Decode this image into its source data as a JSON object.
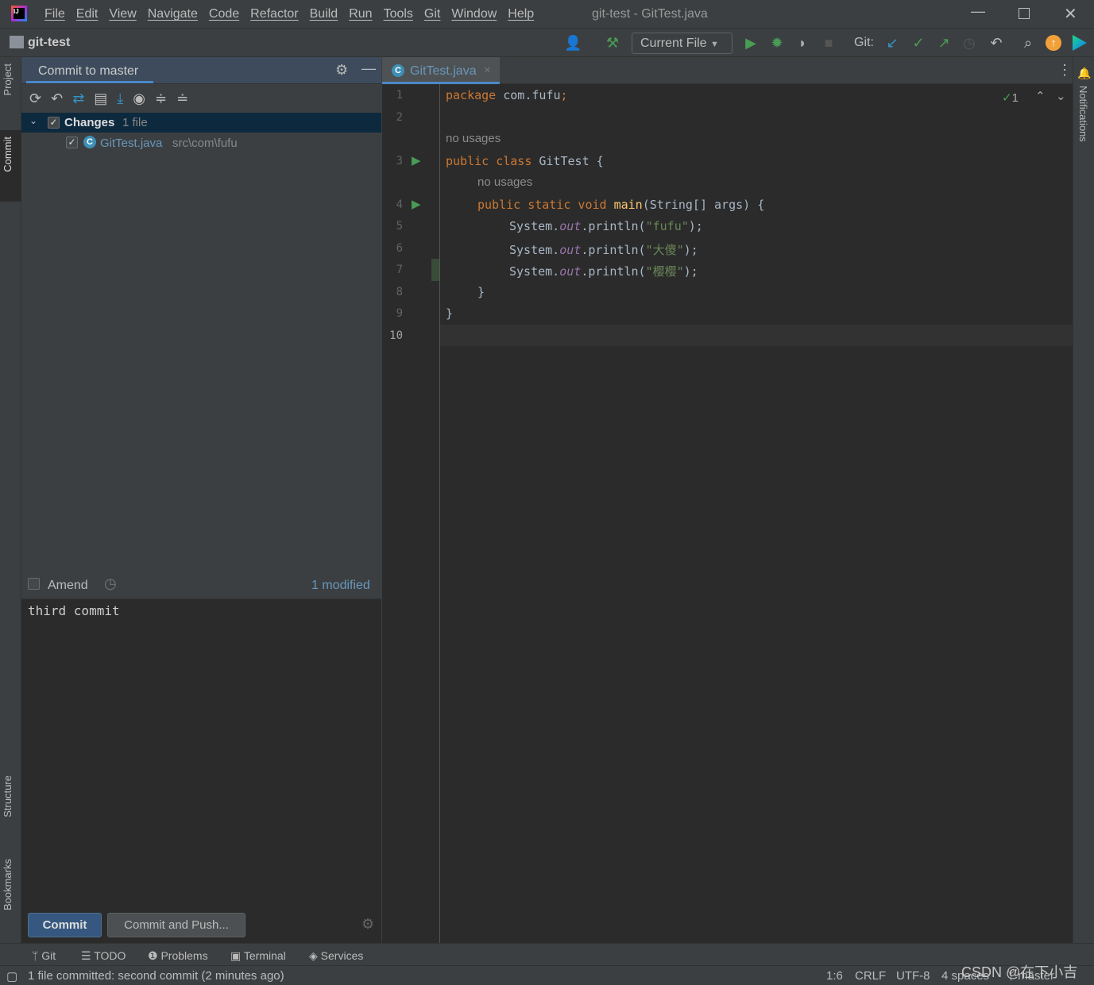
{
  "window": {
    "title": "git-test - GitTest.java",
    "menu": [
      "File",
      "Edit",
      "View",
      "Navigate",
      "Code",
      "Refactor",
      "Build",
      "Run",
      "Tools",
      "Git",
      "Window",
      "Help"
    ]
  },
  "nav": {
    "project": "git-test",
    "run_config": "Current File",
    "git_label": "Git:"
  },
  "left_strip": {
    "tabs": [
      "Project",
      "Commit",
      "Structure",
      "Bookmarks"
    ]
  },
  "right_strip": {
    "tabs": [
      "Notifications"
    ]
  },
  "commit": {
    "title": "Commit to master",
    "changes_label": "Changes",
    "changes_count": "1 file",
    "file_name": "GitTest.java",
    "file_path": "src\\com\\fufu",
    "amend_label": "Amend",
    "modified": "1 modified",
    "message": "third commit",
    "commit_button": "Commit",
    "commit_push_button": "Commit and Push..."
  },
  "editor": {
    "tab": "GitTest.java",
    "inspection_count": "1",
    "hints": {
      "usages": "no usages"
    },
    "line_numbers": [
      "1",
      "2",
      "3",
      "4",
      "5",
      "6",
      "7",
      "8",
      "9",
      "10"
    ],
    "code": {
      "l1_kw": "package",
      "l1_rest": " com.fufu",
      "l1_semi": ";",
      "l3_kw": "public class",
      "l3_rest": " GitTest {",
      "l4_kw": "public static void",
      "l4_fn": " main",
      "l4_rest": "(String[] args) {",
      "sys": "System.",
      "out": "out",
      "println": ".println(",
      "s1": "\"fufu\"",
      "s2": "\"大傻\"",
      "s3": "\"樱樱\"",
      "close": ");",
      "brace": "}"
    }
  },
  "bottom_tabs": [
    "Git",
    "TODO",
    "Problems",
    "Terminal",
    "Services"
  ],
  "status": {
    "message": "1 file committed: second commit (2 minutes ago)",
    "position": "1:6",
    "line_sep": "CRLF",
    "encoding": "UTF-8",
    "indent": "4 spaces",
    "branch": "master",
    "watermark": "CSDN @在下小吉"
  }
}
